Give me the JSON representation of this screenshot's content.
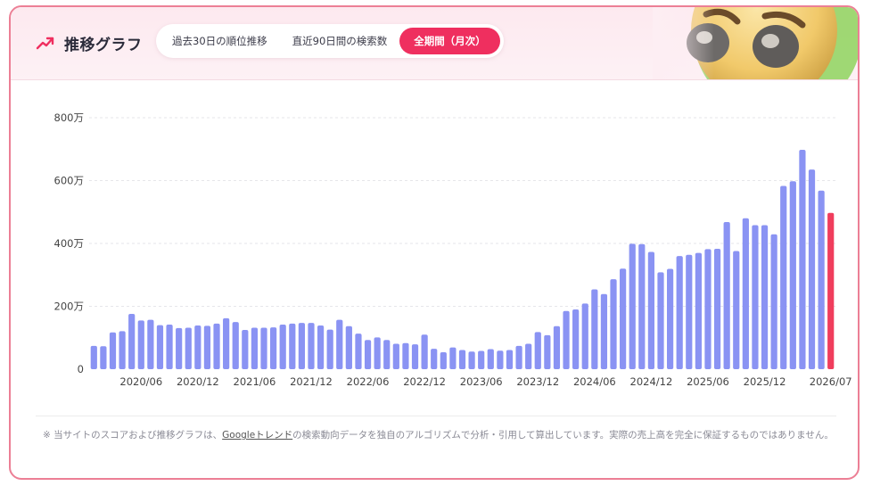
{
  "header": {
    "title": "推移グラフ",
    "tabs": [
      {
        "label": "過去30日の順位推移",
        "active": false
      },
      {
        "label": "直近90日間の検索数",
        "active": false
      },
      {
        "label": "全期間（月次）",
        "active": true
      }
    ]
  },
  "colors": {
    "bar": "#8a93f3",
    "bar_current": "#f03d5c",
    "accent": "#ef2f5f",
    "border": "#ec7f95"
  },
  "note": {
    "before": "※ 当サイトのスコアおよび推移グラフは、",
    "link": "Googleトレンド",
    "after": "の検索動向データを独自のアルゴリズムで分析・引用して算出しています。実際の売上高を完全に保証するものではありません。"
  },
  "chart_data": {
    "type": "bar",
    "ylabel": "",
    "xlabel": "",
    "ylim": [
      0,
      8000000
    ],
    "yticks": [
      {
        "value": 0,
        "label": "0"
      },
      {
        "value": 2000000,
        "label": "200万"
      },
      {
        "value": 4000000,
        "label": "400万"
      },
      {
        "value": 6000000,
        "label": "600万"
      },
      {
        "value": 8000000,
        "label": "800万"
      }
    ],
    "xticks": [
      {
        "index": 5,
        "label": "2020/06"
      },
      {
        "index": 11,
        "label": "2020/12"
      },
      {
        "index": 17,
        "label": "2021/06"
      },
      {
        "index": 23,
        "label": "2021/12"
      },
      {
        "index": 29,
        "label": "2022/06"
      },
      {
        "index": 35,
        "label": "2022/12"
      },
      {
        "index": 41,
        "label": "2023/06"
      },
      {
        "index": 47,
        "label": "2023/12"
      },
      {
        "index": 53,
        "label": "2024/06"
      },
      {
        "index": 59,
        "label": "2024/12"
      },
      {
        "index": 65,
        "label": "2025/06"
      },
      {
        "index": 71,
        "label": "2025/12"
      },
      {
        "index": 78,
        "label": "2026/07"
      }
    ],
    "grid": true,
    "highlight_last": true,
    "categories": [
      "2020/01",
      "2020/02",
      "2020/03",
      "2020/04",
      "2020/05",
      "2020/06",
      "2020/07",
      "2020/08",
      "2020/09",
      "2020/10",
      "2020/11",
      "2020/12",
      "2021/01",
      "2021/02",
      "2021/03",
      "2021/04",
      "2021/05",
      "2021/06",
      "2021/07",
      "2021/08",
      "2021/09",
      "2021/10",
      "2021/11",
      "2021/12",
      "2022/01",
      "2022/02",
      "2022/03",
      "2022/04",
      "2022/05",
      "2022/06",
      "2022/07",
      "2022/08",
      "2022/09",
      "2022/10",
      "2022/11",
      "2022/12",
      "2023/01",
      "2023/02",
      "2023/03",
      "2023/04",
      "2023/05",
      "2023/06",
      "2023/07",
      "2023/08",
      "2023/09",
      "2023/10",
      "2023/11",
      "2023/12",
      "2024/01",
      "2024/02",
      "2024/03",
      "2024/04",
      "2024/05",
      "2024/06",
      "2024/07",
      "2024/08",
      "2024/09",
      "2024/10",
      "2024/11",
      "2024/12",
      "2025/01",
      "2025/02",
      "2025/03",
      "2025/04",
      "2025/05",
      "2025/06",
      "2025/07",
      "2025/08",
      "2025/09",
      "2025/10",
      "2025/11",
      "2025/12",
      "2026/01",
      "2026/02",
      "2026/03",
      "2026/04",
      "2026/05",
      "2026/06",
      "2026/07"
    ],
    "values": [
      740000,
      730000,
      1170000,
      1210000,
      1760000,
      1550000,
      1570000,
      1400000,
      1420000,
      1310000,
      1320000,
      1390000,
      1380000,
      1450000,
      1620000,
      1500000,
      1250000,
      1320000,
      1320000,
      1330000,
      1420000,
      1450000,
      1470000,
      1470000,
      1390000,
      1260000,
      1570000,
      1370000,
      1130000,
      930000,
      1010000,
      930000,
      810000,
      830000,
      790000,
      1100000,
      650000,
      540000,
      690000,
      610000,
      560000,
      580000,
      640000,
      590000,
      610000,
      740000,
      810000,
      1180000,
      1080000,
      1370000,
      1850000,
      1900000,
      2090000,
      2540000,
      2390000,
      2860000,
      3200000,
      3990000,
      3980000,
      3730000,
      3080000,
      3190000,
      3600000,
      3640000,
      3700000,
      3820000,
      3830000,
      4680000,
      3760000,
      4800000,
      4580000,
      4580000,
      4290000,
      5830000,
      5980000,
      6980000,
      6350000,
      5680000,
      4970000
    ]
  }
}
